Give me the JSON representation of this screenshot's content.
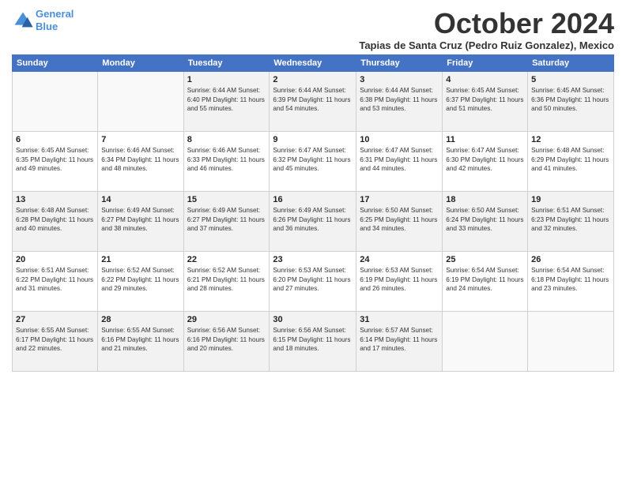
{
  "header": {
    "logo_line1": "General",
    "logo_line2": "Blue",
    "month_title": "October 2024",
    "subtitle": "Tapias de Santa Cruz (Pedro Ruiz Gonzalez), Mexico"
  },
  "weekdays": [
    "Sunday",
    "Monday",
    "Tuesday",
    "Wednesday",
    "Thursday",
    "Friday",
    "Saturday"
  ],
  "rows": [
    [
      {
        "day": "",
        "info": ""
      },
      {
        "day": "",
        "info": ""
      },
      {
        "day": "1",
        "info": "Sunrise: 6:44 AM\nSunset: 6:40 PM\nDaylight: 11 hours and 55 minutes."
      },
      {
        "day": "2",
        "info": "Sunrise: 6:44 AM\nSunset: 6:39 PM\nDaylight: 11 hours and 54 minutes."
      },
      {
        "day": "3",
        "info": "Sunrise: 6:44 AM\nSunset: 6:38 PM\nDaylight: 11 hours and 53 minutes."
      },
      {
        "day": "4",
        "info": "Sunrise: 6:45 AM\nSunset: 6:37 PM\nDaylight: 11 hours and 51 minutes."
      },
      {
        "day": "5",
        "info": "Sunrise: 6:45 AM\nSunset: 6:36 PM\nDaylight: 11 hours and 50 minutes."
      }
    ],
    [
      {
        "day": "6",
        "info": "Sunrise: 6:45 AM\nSunset: 6:35 PM\nDaylight: 11 hours and 49 minutes."
      },
      {
        "day": "7",
        "info": "Sunrise: 6:46 AM\nSunset: 6:34 PM\nDaylight: 11 hours and 48 minutes."
      },
      {
        "day": "8",
        "info": "Sunrise: 6:46 AM\nSunset: 6:33 PM\nDaylight: 11 hours and 46 minutes."
      },
      {
        "day": "9",
        "info": "Sunrise: 6:47 AM\nSunset: 6:32 PM\nDaylight: 11 hours and 45 minutes."
      },
      {
        "day": "10",
        "info": "Sunrise: 6:47 AM\nSunset: 6:31 PM\nDaylight: 11 hours and 44 minutes."
      },
      {
        "day": "11",
        "info": "Sunrise: 6:47 AM\nSunset: 6:30 PM\nDaylight: 11 hours and 42 minutes."
      },
      {
        "day": "12",
        "info": "Sunrise: 6:48 AM\nSunset: 6:29 PM\nDaylight: 11 hours and 41 minutes."
      }
    ],
    [
      {
        "day": "13",
        "info": "Sunrise: 6:48 AM\nSunset: 6:28 PM\nDaylight: 11 hours and 40 minutes."
      },
      {
        "day": "14",
        "info": "Sunrise: 6:49 AM\nSunset: 6:27 PM\nDaylight: 11 hours and 38 minutes."
      },
      {
        "day": "15",
        "info": "Sunrise: 6:49 AM\nSunset: 6:27 PM\nDaylight: 11 hours and 37 minutes."
      },
      {
        "day": "16",
        "info": "Sunrise: 6:49 AM\nSunset: 6:26 PM\nDaylight: 11 hours and 36 minutes."
      },
      {
        "day": "17",
        "info": "Sunrise: 6:50 AM\nSunset: 6:25 PM\nDaylight: 11 hours and 34 minutes."
      },
      {
        "day": "18",
        "info": "Sunrise: 6:50 AM\nSunset: 6:24 PM\nDaylight: 11 hours and 33 minutes."
      },
      {
        "day": "19",
        "info": "Sunrise: 6:51 AM\nSunset: 6:23 PM\nDaylight: 11 hours and 32 minutes."
      }
    ],
    [
      {
        "day": "20",
        "info": "Sunrise: 6:51 AM\nSunset: 6:22 PM\nDaylight: 11 hours and 31 minutes."
      },
      {
        "day": "21",
        "info": "Sunrise: 6:52 AM\nSunset: 6:22 PM\nDaylight: 11 hours and 29 minutes."
      },
      {
        "day": "22",
        "info": "Sunrise: 6:52 AM\nSunset: 6:21 PM\nDaylight: 11 hours and 28 minutes."
      },
      {
        "day": "23",
        "info": "Sunrise: 6:53 AM\nSunset: 6:20 PM\nDaylight: 11 hours and 27 minutes."
      },
      {
        "day": "24",
        "info": "Sunrise: 6:53 AM\nSunset: 6:19 PM\nDaylight: 11 hours and 26 minutes."
      },
      {
        "day": "25",
        "info": "Sunrise: 6:54 AM\nSunset: 6:19 PM\nDaylight: 11 hours and 24 minutes."
      },
      {
        "day": "26",
        "info": "Sunrise: 6:54 AM\nSunset: 6:18 PM\nDaylight: 11 hours and 23 minutes."
      }
    ],
    [
      {
        "day": "27",
        "info": "Sunrise: 6:55 AM\nSunset: 6:17 PM\nDaylight: 11 hours and 22 minutes."
      },
      {
        "day": "28",
        "info": "Sunrise: 6:55 AM\nSunset: 6:16 PM\nDaylight: 11 hours and 21 minutes."
      },
      {
        "day": "29",
        "info": "Sunrise: 6:56 AM\nSunset: 6:16 PM\nDaylight: 11 hours and 20 minutes."
      },
      {
        "day": "30",
        "info": "Sunrise: 6:56 AM\nSunset: 6:15 PM\nDaylight: 11 hours and 18 minutes."
      },
      {
        "day": "31",
        "info": "Sunrise: 6:57 AM\nSunset: 6:14 PM\nDaylight: 11 hours and 17 minutes."
      },
      {
        "day": "",
        "info": ""
      },
      {
        "day": "",
        "info": ""
      }
    ]
  ]
}
